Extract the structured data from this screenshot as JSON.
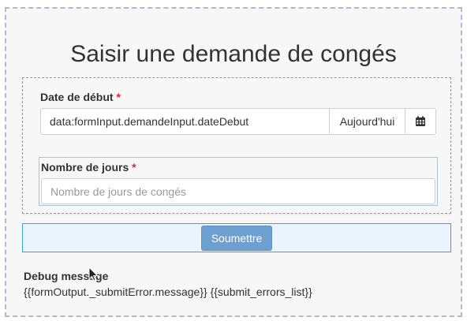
{
  "page": {
    "title": "Saisir une demande de congés"
  },
  "form": {
    "date_debut": {
      "label": "Date de début",
      "required_mark": "*",
      "value": "data:formInput.demandeInput.dateDebut",
      "today_button": "Aujourd'hui",
      "calendar_icon": "calendar-icon"
    },
    "nombre_jours": {
      "label": "Nombre de jours",
      "required_mark": "*",
      "value": "",
      "placeholder": "Nombre de jours de congés"
    },
    "submit_label": "Soumettre"
  },
  "debug": {
    "label": "Debug message",
    "text": "{{formOutput._submitError.message}} {{submit_errors_list}}"
  },
  "colors": {
    "required": "#c9302c",
    "submit_button": "#6d9fd0",
    "submit_row_border": "#3aa3d6"
  }
}
